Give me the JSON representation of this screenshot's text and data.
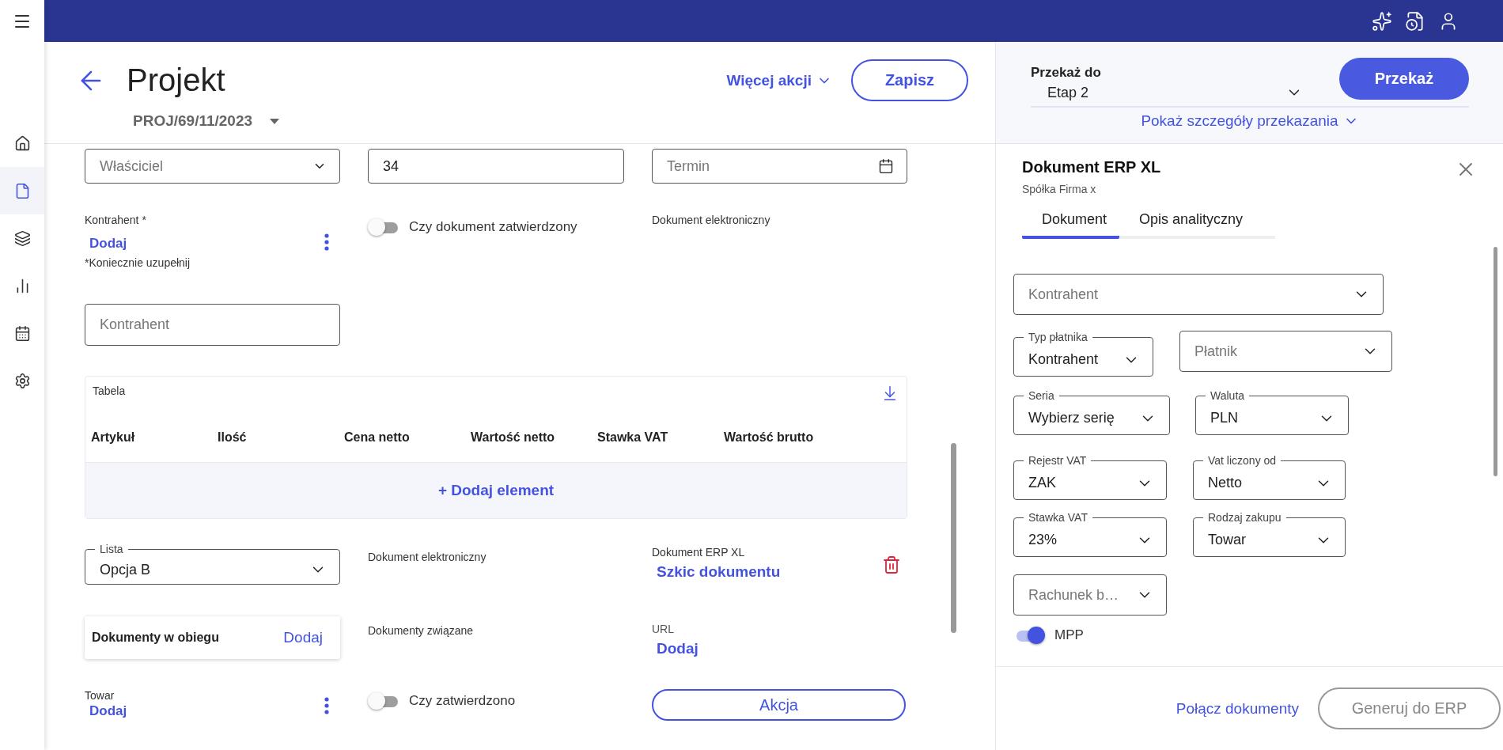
{
  "nav": {
    "items": [
      {
        "selected": false
      },
      {
        "selected": true
      },
      {
        "selected": false
      },
      {
        "selected": false
      },
      {
        "selected": false
      },
      {
        "selected": false
      }
    ]
  },
  "header": {
    "title": "Projekt",
    "number": "PROJ/69/11/2023",
    "more_actions": "Więcej akcji",
    "save": "Zapisz"
  },
  "form": {
    "top_fields": [
      {
        "kind": "select",
        "placeholder": "Właściciel"
      },
      {
        "kind": "input",
        "value": "34"
      },
      {
        "kind": "date",
        "placeholder": "Termin"
      }
    ],
    "kontrahent": {
      "label": "Kontrahent *",
      "link": "Dodaj",
      "hint": "*Koniecznie uzupełnij"
    },
    "approved_toggle": {
      "label": "Czy dokument zatwierdzony",
      "on": false
    },
    "edoc_label": "Dokument elektroniczny",
    "kontrahent_input": {
      "placeholder": "Kontrahent"
    },
    "table": {
      "title": "Tabela",
      "columns": [
        "Artykuł",
        "Ilość",
        "Cena netto",
        "Wartość netto",
        "Stawka VAT",
        "Wartość brutto"
      ],
      "add": "+ Dodaj element"
    },
    "lista": {
      "label": "Lista",
      "value": "Opcja B"
    },
    "edoc2_label": "Dokument elektroniczny",
    "erp": {
      "label": "Dokument ERP XL",
      "link": "Szkic dokumentu"
    },
    "circulation": {
      "label": "Dokumenty w obiegu",
      "link": "Dodaj"
    },
    "related_label": "Dokumenty związane",
    "url": {
      "label": "URL",
      "link": "Dodaj"
    },
    "towar": {
      "label": "Towar",
      "link": "Dodaj"
    },
    "confirmed_toggle": {
      "label": "Czy zatwierdzono",
      "on": false
    },
    "action": "Akcja"
  },
  "transfer": {
    "label": "Przekaż do",
    "value": "Etap 2",
    "button": "Przekaż",
    "details": "Pokaż szczegóły przekazania"
  },
  "panel": {
    "title": "Dokument ERP XL",
    "subtitle": "Spółka Firma x",
    "tabs": [
      {
        "label": "Dokument",
        "selected": true
      },
      {
        "label": "Opis analityczny",
        "selected": false
      }
    ],
    "fields": [
      [
        {
          "placeholder": "Kontrahent"
        }
      ],
      [
        {
          "label": "Typ płatnika",
          "value": "Kontrahent"
        },
        {
          "placeholder": "Płatnik"
        }
      ],
      [
        {
          "label": "Seria",
          "value": "Wybierz serię"
        },
        {
          "label": "Waluta",
          "value": "PLN"
        }
      ],
      [
        {
          "label": "Rejestr VAT",
          "value": "ZAK"
        },
        {
          "label": "Vat liczony od",
          "value": "Netto"
        }
      ],
      [
        {
          "label": "Stawka VAT",
          "value": "23%"
        },
        {
          "label": "Rodzaj zakupu",
          "value": "Towar"
        }
      ],
      [
        {
          "placeholder": "Rachunek b…"
        }
      ]
    ],
    "mpp": {
      "label": "MPP",
      "on": true
    },
    "link": "Połącz dokumenty",
    "generate": {
      "label": "Generuj do ERP",
      "disabled": true
    }
  }
}
